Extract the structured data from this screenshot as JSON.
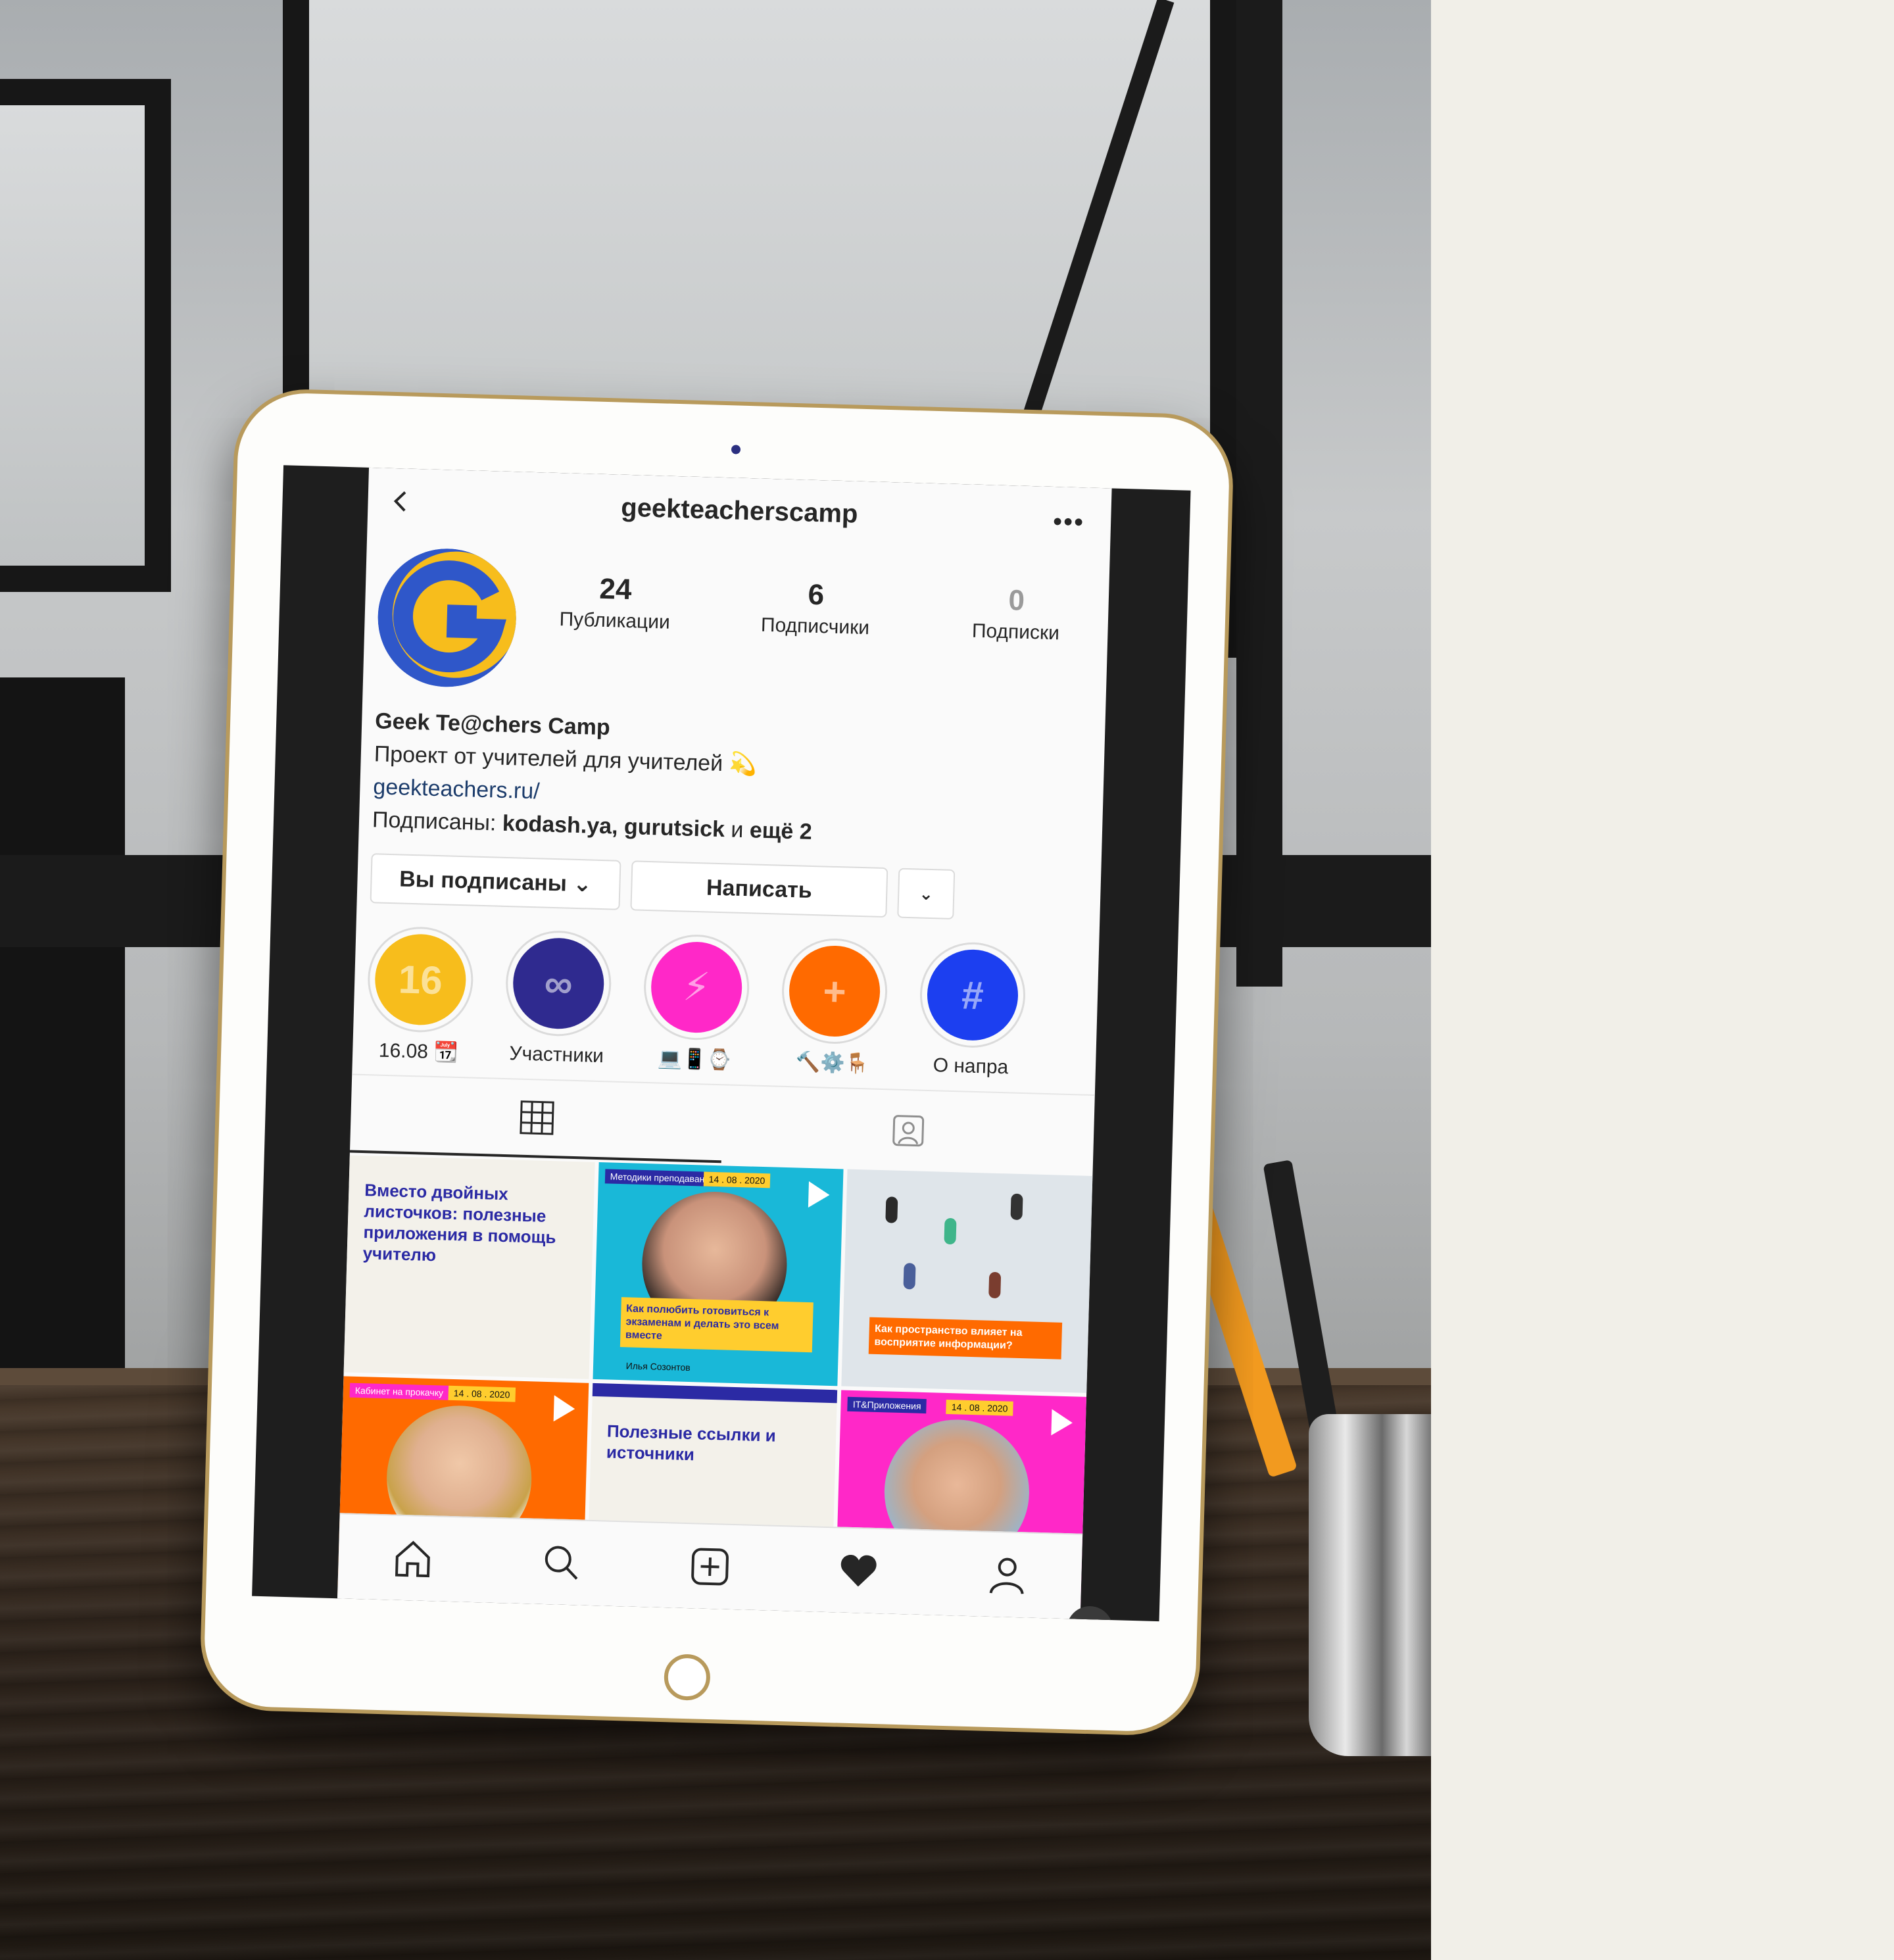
{
  "profile": {
    "username": "geekteacherscamp",
    "stats": [
      {
        "value": "24",
        "label": "Публикации"
      },
      {
        "value": "6",
        "label": "Подписчики"
      },
      {
        "value": "0",
        "label": "Подписки"
      }
    ],
    "display_name": "Geek Te@chers Camp",
    "bio": "Проект от учителей для учителей 💫",
    "link": "geekteachers.ru/",
    "followed_by_prefix": "Подписаны:",
    "followed_by_names": "kodash.ya, gurutsick",
    "followed_by_and": "и",
    "followed_by_more": "ещё 2"
  },
  "actions": {
    "following_label": "Вы подписаны ⌄",
    "message_label": "Написать",
    "more_label": "⌄"
  },
  "highlights": [
    {
      "label": "16.08 📆",
      "glyph": "16",
      "color": "#f7bd1c"
    },
    {
      "label": "Участники",
      "glyph": "∞",
      "color": "#2f2a8f"
    },
    {
      "label": "💻📱⌚",
      "glyph": "⚡",
      "color": "#ff28c8"
    },
    {
      "label": "🔨⚙️🪑",
      "glyph": "+",
      "color": "#ff6a00"
    },
    {
      "label": "О напра",
      "glyph": "#",
      "color": "#1c3ff0"
    }
  ],
  "posts": [
    {
      "type": "text",
      "text": "Вместо двойных листочков: полезные приложения в помощь учителю",
      "bg": "#f3f1ea"
    },
    {
      "type": "video",
      "tag": "Методики преподавания",
      "date": "14 . 08 . 2020",
      "caption": "Как полюбить готовиться к экзаменам и делать это всем вместе",
      "name": "Илья Созонтов",
      "bg": "#19b8d8"
    },
    {
      "type": "photo",
      "caption": "Как пространство влияет на восприятие информации?",
      "bg": "#dfe5ea"
    },
    {
      "type": "video",
      "tag": "Кабинет на прокачку",
      "date": "14 . 08 . 2020",
      "bg": "#ff6a00"
    },
    {
      "type": "text",
      "text": "Полезные ссылки и источники",
      "bg": "#f3f1ea"
    },
    {
      "type": "video",
      "tag": "IT&Приложения",
      "date": "14 . 08 . 2020",
      "bg": "#ff28c8"
    }
  ],
  "colors": {
    "ig_text": "#262626",
    "link": "#1c3c6b",
    "tablet_gold": "#b89a5c",
    "avatar_blue": "#2f57c9",
    "avatar_yellow": "#f7bd1c"
  }
}
